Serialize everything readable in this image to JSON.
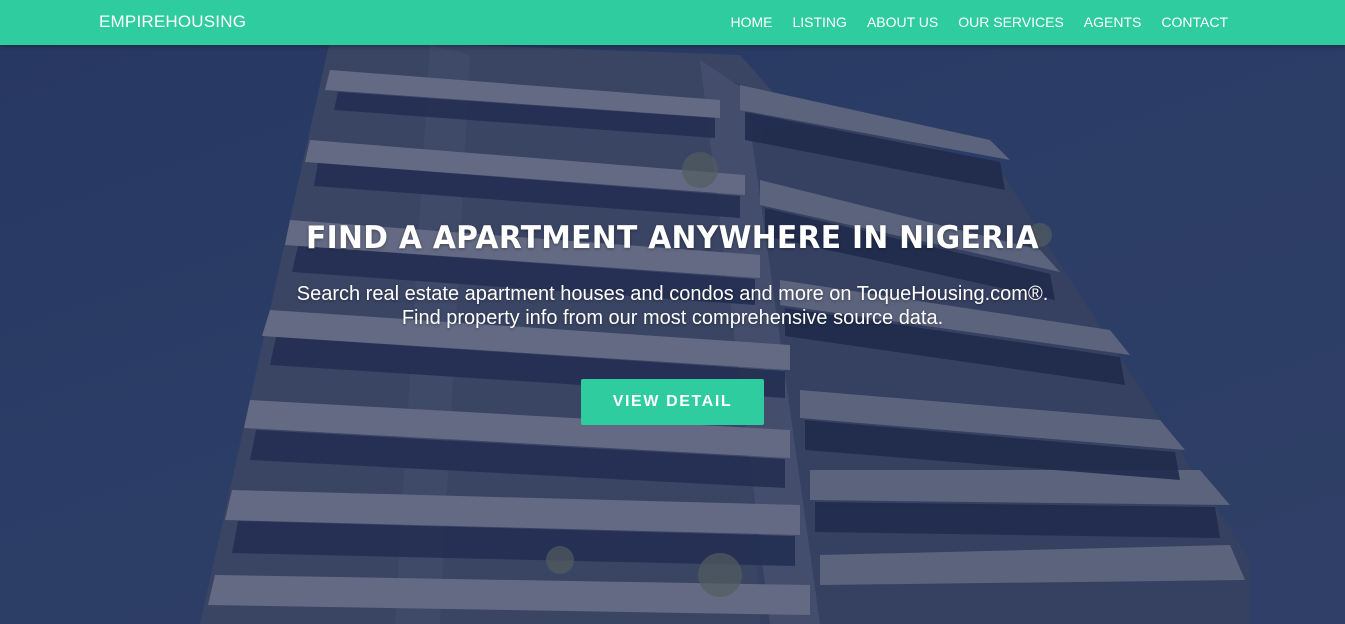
{
  "navbar": {
    "brand": "EMPIREHOUSING",
    "links": [
      {
        "label": "HOME"
      },
      {
        "label": "LISTING"
      },
      {
        "label": "ABOUT US"
      },
      {
        "label": "OUR SERVICES"
      },
      {
        "label": "AGENTS"
      },
      {
        "label": "CONTACT"
      }
    ]
  },
  "hero": {
    "title": "FIND A APARTMENT ANYWHERE IN NIGERIA",
    "subtitle_line1": "Search real estate apartment houses and condos and more on ToqueHousing.com®.",
    "subtitle_line2": "Find property info from our most comprehensive source data.",
    "cta_label": "VIEW DETAIL"
  },
  "colors": {
    "accent": "#2ecc9e",
    "hero_overlay": "#2f4470",
    "text": "#ffffff"
  }
}
